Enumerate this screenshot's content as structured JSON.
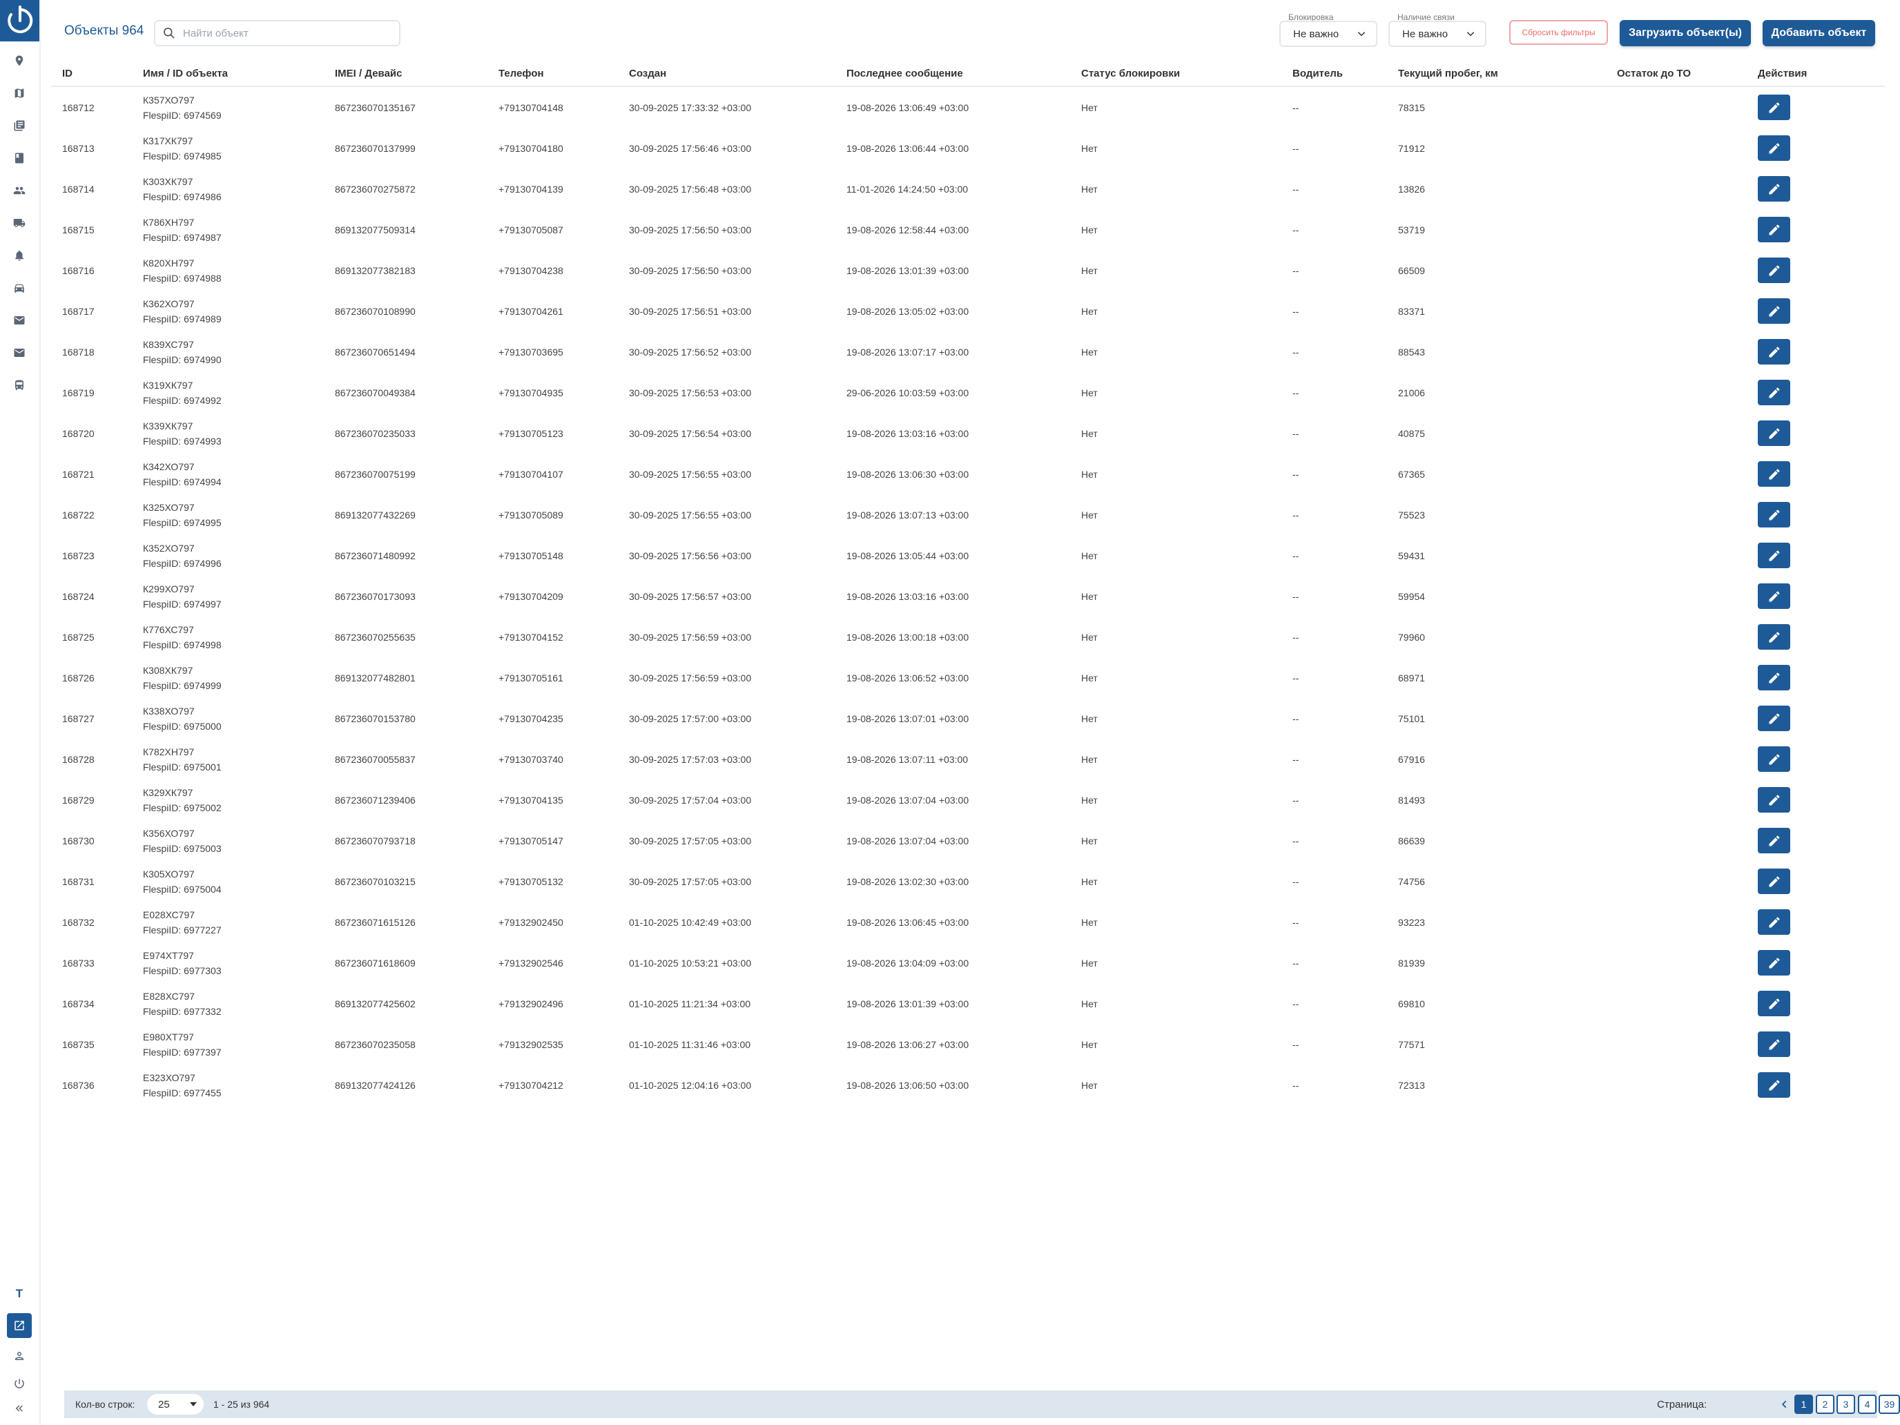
{
  "header": {
    "title": "Объекты 964",
    "search_placeholder": "Найти объект",
    "filters": [
      {
        "label": "Блокировка",
        "value": "Не важно"
      },
      {
        "label": "Наличие связи",
        "value": "Не важно"
      }
    ],
    "reset_label": "Сбросить фильтры",
    "upload_label": "Загрузить объект(ы)",
    "add_label": "Добавить объект"
  },
  "sidebar": {
    "user_initial": "T",
    "icons": [
      "map-marker-icon",
      "map-icon",
      "documents-icon",
      "book-icon",
      "users-icon",
      "truck-icon",
      "bell-icon",
      "car-icon",
      "mail-icon",
      "mail-secondary-icon",
      "bus-icon"
    ],
    "bottom_icons": [
      "external-link-icon",
      "user-icon",
      "power-icon",
      "collapse-icon"
    ]
  },
  "columns": [
    "ID",
    "Имя / ID объекта",
    "IMEI / Девайс",
    "Телефон",
    "Создан",
    "Последнее сообщение",
    "Статус блокировки",
    "Водитель",
    "Текущий пробег, км",
    "Остаток до ТО",
    "Действия"
  ],
  "rows": [
    {
      "id": "168712",
      "name": "К357ХО797",
      "flespi": "FlespiID: 6974569",
      "imei": "867236070135167",
      "phone": "+79130704148",
      "created": "30-09-2025 17:33:32 +03:00",
      "last": "19-08-2026 13:06:49 +03:00",
      "status": "Нет",
      "driver": "--",
      "mileage": "78315",
      "to": ""
    },
    {
      "id": "168713",
      "name": "К317ХК797",
      "flespi": "FlespiID: 6974985",
      "imei": "867236070137999",
      "phone": "+79130704180",
      "created": "30-09-2025 17:56:46 +03:00",
      "last": "19-08-2026 13:06:44 +03:00",
      "status": "Нет",
      "driver": "--",
      "mileage": "71912",
      "to": ""
    },
    {
      "id": "168714",
      "name": "К303ХК797",
      "flespi": "FlespiID: 6974986",
      "imei": "867236070275872",
      "phone": "+79130704139",
      "created": "30-09-2025 17:56:48 +03:00",
      "last": "11-01-2026 14:24:50 +03:00",
      "status": "Нет",
      "driver": "--",
      "mileage": "13826",
      "to": ""
    },
    {
      "id": "168715",
      "name": "К786ХН797",
      "flespi": "FlespiID: 6974987",
      "imei": "869132077509314",
      "phone": "+79130705087",
      "created": "30-09-2025 17:56:50 +03:00",
      "last": "19-08-2026 12:58:44 +03:00",
      "status": "Нет",
      "driver": "--",
      "mileage": "53719",
      "to": ""
    },
    {
      "id": "168716",
      "name": "К820ХН797",
      "flespi": "FlespiID: 6974988",
      "imei": "869132077382183",
      "phone": "+79130704238",
      "created": "30-09-2025 17:56:50 +03:00",
      "last": "19-08-2026 13:01:39 +03:00",
      "status": "Нет",
      "driver": "--",
      "mileage": "66509",
      "to": ""
    },
    {
      "id": "168717",
      "name": "К362ХО797",
      "flespi": "FlespiID: 6974989",
      "imei": "867236070108990",
      "phone": "+79130704261",
      "created": "30-09-2025 17:56:51 +03:00",
      "last": "19-08-2026 13:05:02 +03:00",
      "status": "Нет",
      "driver": "--",
      "mileage": "83371",
      "to": ""
    },
    {
      "id": "168718",
      "name": "К839ХС797",
      "flespi": "FlespiID: 6974990",
      "imei": "867236070651494",
      "phone": "+79130703695",
      "created": "30-09-2025 17:56:52 +03:00",
      "last": "19-08-2026 13:07:17 +03:00",
      "status": "Нет",
      "driver": "--",
      "mileage": "88543",
      "to": ""
    },
    {
      "id": "168719",
      "name": "К319ХК797",
      "flespi": "FlespiID: 6974992",
      "imei": "867236070049384",
      "phone": "+79130704935",
      "created": "30-09-2025 17:56:53 +03:00",
      "last": "29-06-2026 10:03:59 +03:00",
      "status": "Нет",
      "driver": "--",
      "mileage": "21006",
      "to": ""
    },
    {
      "id": "168720",
      "name": "К339ХК797",
      "flespi": "FlespiID: 6974993",
      "imei": "867236070235033",
      "phone": "+79130705123",
      "created": "30-09-2025 17:56:54 +03:00",
      "last": "19-08-2026 13:03:16 +03:00",
      "status": "Нет",
      "driver": "--",
      "mileage": "40875",
      "to": ""
    },
    {
      "id": "168721",
      "name": "К342ХО797",
      "flespi": "FlespiID: 6974994",
      "imei": "867236070075199",
      "phone": "+79130704107",
      "created": "30-09-2025 17:56:55 +03:00",
      "last": "19-08-2026 13:06:30 +03:00",
      "status": "Нет",
      "driver": "--",
      "mileage": "67365",
      "to": ""
    },
    {
      "id": "168722",
      "name": "К325ХО797",
      "flespi": "FlespiID: 6974995",
      "imei": "869132077432269",
      "phone": "+79130705089",
      "created": "30-09-2025 17:56:55 +03:00",
      "last": "19-08-2026 13:07:13 +03:00",
      "status": "Нет",
      "driver": "--",
      "mileage": "75523",
      "to": ""
    },
    {
      "id": "168723",
      "name": "К352ХО797",
      "flespi": "FlespiID: 6974996",
      "imei": "867236071480992",
      "phone": "+79130705148",
      "created": "30-09-2025 17:56:56 +03:00",
      "last": "19-08-2026 13:05:44 +03:00",
      "status": "Нет",
      "driver": "--",
      "mileage": "59431",
      "to": ""
    },
    {
      "id": "168724",
      "name": "К299ХО797",
      "flespi": "FlespiID: 6974997",
      "imei": "867236070173093",
      "phone": "+79130704209",
      "created": "30-09-2025 17:56:57 +03:00",
      "last": "19-08-2026 13:03:16 +03:00",
      "status": "Нет",
      "driver": "--",
      "mileage": "59954",
      "to": ""
    },
    {
      "id": "168725",
      "name": "К776ХС797",
      "flespi": "FlespiID: 6974998",
      "imei": "867236070255635",
      "phone": "+79130704152",
      "created": "30-09-2025 17:56:59 +03:00",
      "last": "19-08-2026 13:00:18 +03:00",
      "status": "Нет",
      "driver": "--",
      "mileage": "79960",
      "to": ""
    },
    {
      "id": "168726",
      "name": "К308ХК797",
      "flespi": "FlespiID: 6974999",
      "imei": "869132077482801",
      "phone": "+79130705161",
      "created": "30-09-2025 17:56:59 +03:00",
      "last": "19-08-2026 13:06:52 +03:00",
      "status": "Нет",
      "driver": "--",
      "mileage": "68971",
      "to": ""
    },
    {
      "id": "168727",
      "name": "К338ХО797",
      "flespi": "FlespiID: 6975000",
      "imei": "867236070153780",
      "phone": "+79130704235",
      "created": "30-09-2025 17:57:00 +03:00",
      "last": "19-08-2026 13:07:01 +03:00",
      "status": "Нет",
      "driver": "--",
      "mileage": "75101",
      "to": ""
    },
    {
      "id": "168728",
      "name": "К782ХН797",
      "flespi": "FlespiID: 6975001",
      "imei": "867236070055837",
      "phone": "+79130703740",
      "created": "30-09-2025 17:57:03 +03:00",
      "last": "19-08-2026 13:07:11 +03:00",
      "status": "Нет",
      "driver": "--",
      "mileage": "67916",
      "to": ""
    },
    {
      "id": "168729",
      "name": "К329ХК797",
      "flespi": "FlespiID: 6975002",
      "imei": "867236071239406",
      "phone": "+79130704135",
      "created": "30-09-2025 17:57:04 +03:00",
      "last": "19-08-2026 13:07:04 +03:00",
      "status": "Нет",
      "driver": "--",
      "mileage": "81493",
      "to": ""
    },
    {
      "id": "168730",
      "name": "К356ХО797",
      "flespi": "FlespiID: 6975003",
      "imei": "867236070793718",
      "phone": "+79130705147",
      "created": "30-09-2025 17:57:05 +03:00",
      "last": "19-08-2026 13:07:04 +03:00",
      "status": "Нет",
      "driver": "--",
      "mileage": "86639",
      "to": ""
    },
    {
      "id": "168731",
      "name": "К305ХО797",
      "flespi": "FlespiID: 6975004",
      "imei": "867236070103215",
      "phone": "+79130705132",
      "created": "30-09-2025 17:57:05 +03:00",
      "last": "19-08-2026 13:02:30 +03:00",
      "status": "Нет",
      "driver": "--",
      "mileage": "74756",
      "to": ""
    },
    {
      "id": "168732",
      "name": "Е028ХС797",
      "flespi": "FlespiID: 6977227",
      "imei": "867236071615126",
      "phone": "+79132902450",
      "created": "01-10-2025 10:42:49 +03:00",
      "last": "19-08-2026 13:06:45 +03:00",
      "status": "Нет",
      "driver": "--",
      "mileage": "93223",
      "to": ""
    },
    {
      "id": "168733",
      "name": "Е974ХТ797",
      "flespi": "FlespiID: 6977303",
      "imei": "867236071618609",
      "phone": "+79132902546",
      "created": "01-10-2025 10:53:21 +03:00",
      "last": "19-08-2026 13:04:09 +03:00",
      "status": "Нет",
      "driver": "--",
      "mileage": "81939",
      "to": ""
    },
    {
      "id": "168734",
      "name": "Е828ХС797",
      "flespi": "FlespiID: 6977332",
      "imei": "869132077425602",
      "phone": "+79132902496",
      "created": "01-10-2025 11:21:34 +03:00",
      "last": "19-08-2026 13:01:39 +03:00",
      "status": "Нет",
      "driver": "--",
      "mileage": "69810",
      "to": ""
    },
    {
      "id": "168735",
      "name": "Е980ХТ797",
      "flespi": "FlespiID: 6977397",
      "imei": "867236070235058",
      "phone": "+79132902535",
      "created": "01-10-2025 11:31:46 +03:00",
      "last": "19-08-2026 13:06:27 +03:00",
      "status": "Нет",
      "driver": "--",
      "mileage": "77571",
      "to": ""
    },
    {
      "id": "168736",
      "name": "Е323ХО797",
      "flespi": "FlespiID: 6977455",
      "imei": "869132077424126",
      "phone": "+79130704212",
      "created": "01-10-2025 12:04:16 +03:00",
      "last": "19-08-2026 13:06:50 +03:00",
      "status": "Нет",
      "driver": "--",
      "mileage": "72313",
      "to": ""
    }
  ],
  "footer": {
    "rows_label": "Кол-во строк:",
    "rows_value": "25",
    "range": "1 - 25 из 964",
    "page_label": "Страница:",
    "pages": [
      "1",
      "2",
      "3",
      "4",
      "39"
    ],
    "active_page": "1"
  },
  "colors": {
    "accent": "#1e5a97",
    "reset": "#ef6b6b",
    "footer_bg": "#dde5ee"
  }
}
